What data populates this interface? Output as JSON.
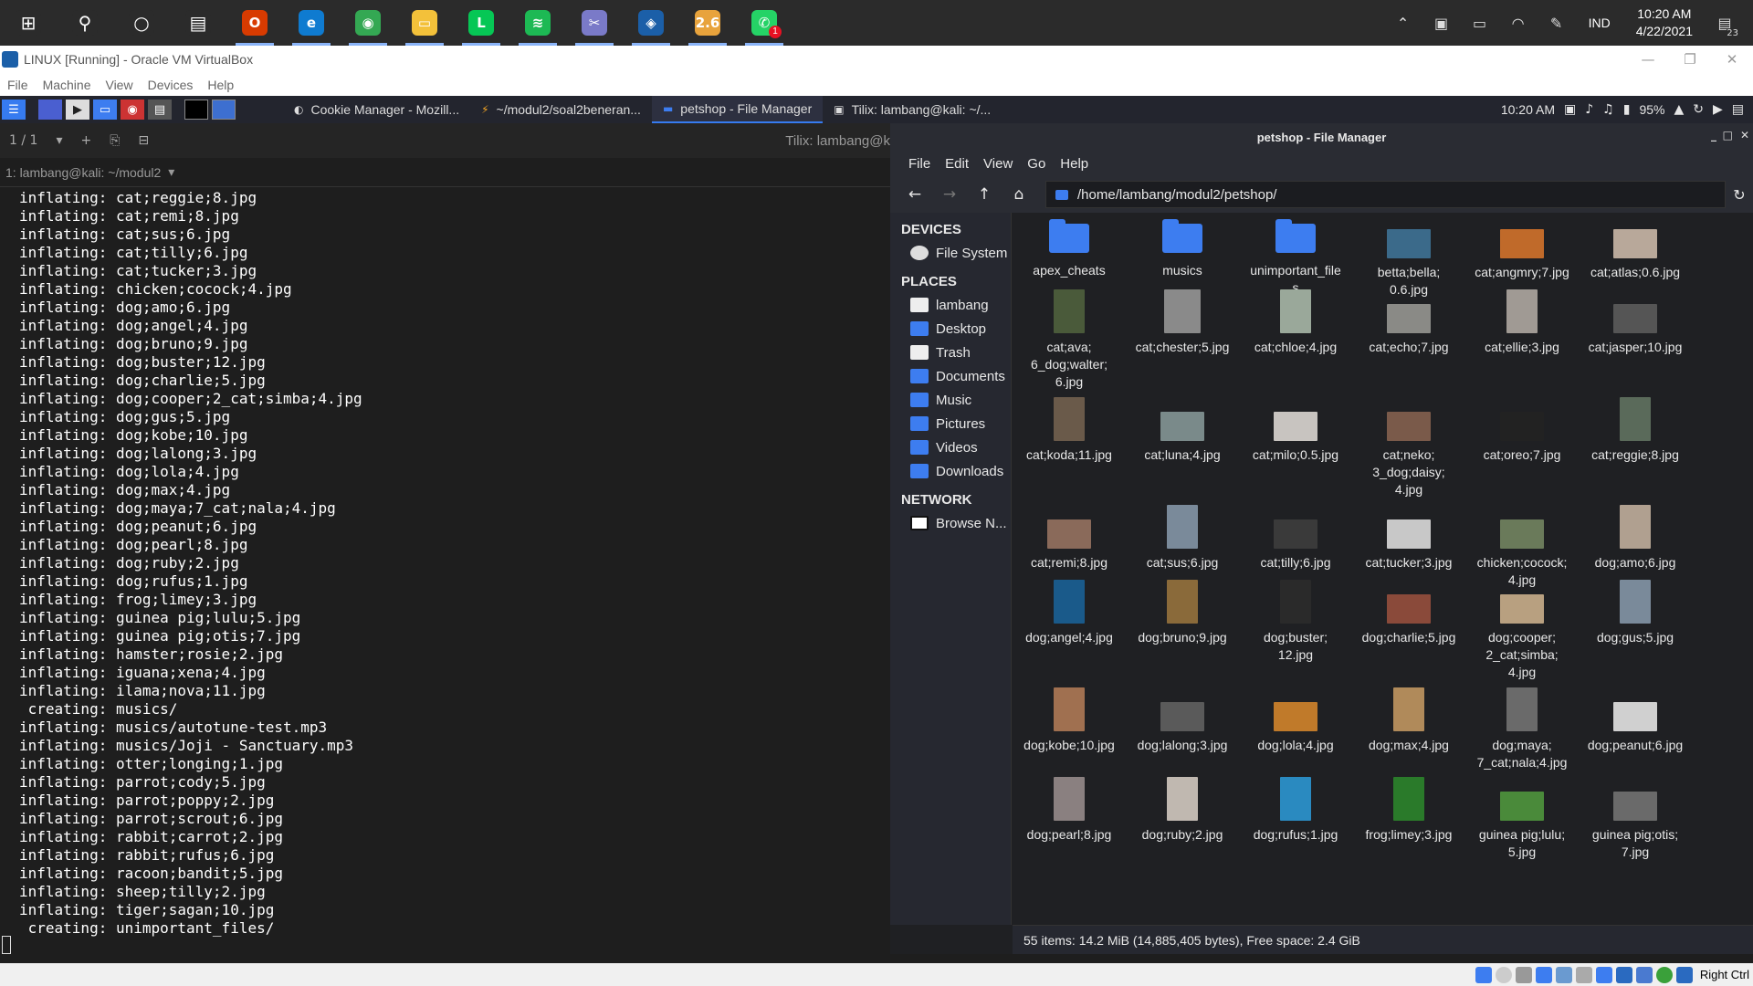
{
  "taskbar": {
    "apps": [
      {
        "name": "start",
        "glyph": "⊞",
        "color": "#2b2b2b"
      },
      {
        "name": "search",
        "glyph": "⚲",
        "color": "#2b2b2b"
      },
      {
        "name": "cortana",
        "glyph": "○",
        "color": "#2b2b2b"
      },
      {
        "name": "task-view",
        "glyph": "▤",
        "color": "#2b2b2b"
      },
      {
        "name": "office",
        "glyph": "O",
        "color": "#d83b01"
      },
      {
        "name": "edge",
        "glyph": "e",
        "color": "#0f7bd0"
      },
      {
        "name": "chrome",
        "glyph": "◉",
        "color": "#34a853"
      },
      {
        "name": "file-explorer",
        "glyph": "▭",
        "color": "#f3c13a"
      },
      {
        "name": "line",
        "glyph": "L",
        "color": "#06c755"
      },
      {
        "name": "spotify",
        "glyph": "≋",
        "color": "#1db954"
      },
      {
        "name": "snip",
        "glyph": "✂",
        "color": "#7a7ac8"
      },
      {
        "name": "virtualbox",
        "glyph": "◈",
        "color": "#1b5fa8"
      },
      {
        "name": "app-26",
        "glyph": "2.6",
        "color": "#e8a33c"
      },
      {
        "name": "whatsapp",
        "glyph": "✆",
        "color": "#25d366"
      }
    ],
    "whatsapp_badge": "1",
    "lang": "IND",
    "time": "10:20 AM",
    "date": "4/22/2021",
    "notif_count": "23"
  },
  "vbox": {
    "title": "LINUX [Running] - Oracle VM VirtualBox",
    "menu": [
      "File",
      "Machine",
      "View",
      "Devices",
      "Help"
    ],
    "host_key": "Right Ctrl"
  },
  "kali_panel": {
    "tasks": [
      {
        "label": "Cookie Manager - Mozill...",
        "glyph": "◐"
      },
      {
        "label": "~/modul2/soal2beneran...",
        "glyph": "⚡"
      },
      {
        "label": "petshop - File Manager",
        "glyph": "▬"
      },
      {
        "label": "Tilix: lambang@kali: ~/...",
        "glyph": "▣"
      }
    ],
    "time": "10:20 AM",
    "battery": "95%"
  },
  "tilix": {
    "counter": "1 / 1",
    "title": "Tilix: lambang@k",
    "session": "1: lambang@kali: ~/modul2",
    "lines": [
      "inflating: cat;reggie;8.jpg",
      "inflating: cat;remi;8.jpg",
      "inflating: cat;sus;6.jpg",
      "inflating: cat;tilly;6.jpg",
      "inflating: cat;tucker;3.jpg",
      "inflating: chicken;cocock;4.jpg",
      "inflating: dog;amo;6.jpg",
      "inflating: dog;angel;4.jpg",
      "inflating: dog;bruno;9.jpg",
      "inflating: dog;buster;12.jpg",
      "inflating: dog;charlie;5.jpg",
      "inflating: dog;cooper;2_cat;simba;4.jpg",
      "inflating: dog;gus;5.jpg",
      "inflating: dog;kobe;10.jpg",
      "inflating: dog;lalong;3.jpg",
      "inflating: dog;lola;4.jpg",
      "inflating: dog;max;4.jpg",
      "inflating: dog;maya;7_cat;nala;4.jpg",
      "inflating: dog;peanut;6.jpg",
      "inflating: dog;pearl;8.jpg",
      "inflating: dog;ruby;2.jpg",
      "inflating: dog;rufus;1.jpg",
      "inflating: frog;limey;3.jpg",
      "inflating: guinea pig;lulu;5.jpg",
      "inflating: guinea pig;otis;7.jpg",
      "inflating: hamster;rosie;2.jpg",
      "inflating: iguana;xena;4.jpg",
      "inflating: ilama;nova;11.jpg",
      " creating: musics/",
      "inflating: musics/autotune-test.mp3",
      "inflating: musics/Joji - Sanctuary.mp3",
      "inflating: otter;longing;1.jpg",
      "inflating: parrot;cody;5.jpg",
      "inflating: parrot;poppy;2.jpg",
      "inflating: parrot;scrout;6.jpg",
      "inflating: rabbit;carrot;2.jpg",
      "inflating: rabbit;rufus;6.jpg",
      "inflating: racoon;bandit;5.jpg",
      "inflating: sheep;tilly;2.jpg",
      "inflating: tiger;sagan;10.jpg",
      " creating: unimportant_files/"
    ]
  },
  "file_manager": {
    "title": "petshop - File Manager",
    "menu": [
      "File",
      "Edit",
      "View",
      "Go",
      "Help"
    ],
    "path": "/home/lambang/modul2/petshop/",
    "sidebar": {
      "devices_label": "DEVICES",
      "devices": [
        {
          "label": "File System",
          "icon": "dev"
        }
      ],
      "places_label": "PLACES",
      "places": [
        {
          "label": "lambang",
          "icon": "white"
        },
        {
          "label": "Desktop",
          "icon": "blue"
        },
        {
          "label": "Trash",
          "icon": "white"
        },
        {
          "label": "Documents",
          "icon": "blue"
        },
        {
          "label": "Music",
          "icon": "blue"
        },
        {
          "label": "Pictures",
          "icon": "blue"
        },
        {
          "label": "Videos",
          "icon": "blue"
        },
        {
          "label": "Downloads",
          "icon": "blue"
        }
      ],
      "network_label": "NETWORK",
      "network": [
        {
          "label": "Browse N...",
          "icon": "net"
        }
      ]
    },
    "items": [
      {
        "lines": [
          "apex_cheats"
        ],
        "type": "folder"
      },
      {
        "lines": [
          "musics"
        ],
        "type": "folder"
      },
      {
        "lines": [
          "unimportant_file",
          "s"
        ],
        "type": "folder"
      },
      {
        "lines": [
          "betta;bella;",
          "0.6.jpg"
        ],
        "type": "image",
        "color": "#3b6a8a",
        "shape": "land"
      },
      {
        "lines": [
          "cat;angmry;7.jpg"
        ],
        "type": "image",
        "color": "#c06a2a",
        "shape": "land"
      },
      {
        "lines": [
          "cat;atlas;0.6.jpg"
        ],
        "type": "image",
        "color": "#b8a89a",
        "shape": "land"
      },
      {
        "lines": [
          "cat;ava;",
          "6_dog;walter;",
          "6.jpg"
        ],
        "type": "image",
        "color": "#4a5a3a",
        "shape": "tall"
      },
      {
        "lines": [
          "cat;chester;5.jpg"
        ],
        "type": "image",
        "color": "#8a8a8a",
        "shape": "sq"
      },
      {
        "lines": [
          "cat;chloe;4.jpg"
        ],
        "type": "image",
        "color": "#9aa89a",
        "shape": "tall"
      },
      {
        "lines": [
          "cat;echo;7.jpg"
        ],
        "type": "image",
        "color": "#8a8a86",
        "shape": "land"
      },
      {
        "lines": [
          "cat;ellie;3.jpg"
        ],
        "type": "image",
        "color": "#a09a94",
        "shape": "tall"
      },
      {
        "lines": [
          "cat;jasper;10.jpg"
        ],
        "type": "image",
        "color": "#555555",
        "shape": "land"
      },
      {
        "lines": [
          "cat;koda;11.jpg"
        ],
        "type": "image",
        "color": "#6a5a4a",
        "shape": "tall"
      },
      {
        "lines": [
          "cat;luna;4.jpg"
        ],
        "type": "image",
        "color": "#7a8a8a",
        "shape": "land"
      },
      {
        "lines": [
          "cat;milo;0.5.jpg"
        ],
        "type": "image",
        "color": "#c8c4c0",
        "shape": "land"
      },
      {
        "lines": [
          "cat;neko;",
          "3_dog;daisy;",
          "4.jpg"
        ],
        "type": "image",
        "color": "#7a5a4a",
        "shape": "land"
      },
      {
        "lines": [
          "cat;oreo;7.jpg"
        ],
        "type": "image",
        "color": "#222222",
        "shape": "land"
      },
      {
        "lines": [
          "cat;reggie;8.jpg"
        ],
        "type": "image",
        "color": "#5a6a5a",
        "shape": "tall"
      },
      {
        "lines": [
          "cat;remi;8.jpg"
        ],
        "type": "image",
        "color": "#8a6a5a",
        "shape": "land"
      },
      {
        "lines": [
          "cat;sus;6.jpg"
        ],
        "type": "image",
        "color": "#7a8a9a",
        "shape": "tall"
      },
      {
        "lines": [
          "cat;tilly;6.jpg"
        ],
        "type": "image",
        "color": "#3a3a3a",
        "shape": "land"
      },
      {
        "lines": [
          "cat;tucker;3.jpg"
        ],
        "type": "image",
        "color": "#c8c8c8",
        "shape": "land"
      },
      {
        "lines": [
          "chicken;cocock;",
          "4.jpg"
        ],
        "type": "image",
        "color": "#6a7a5a",
        "shape": "land"
      },
      {
        "lines": [
          "dog;amo;6.jpg"
        ],
        "type": "image",
        "color": "#b0a090",
        "shape": "tall"
      },
      {
        "lines": [
          "dog;angel;4.jpg"
        ],
        "type": "image",
        "color": "#1a5a8a",
        "shape": "tall"
      },
      {
        "lines": [
          "dog;bruno;9.jpg"
        ],
        "type": "image",
        "color": "#8a6a3a",
        "shape": "tall"
      },
      {
        "lines": [
          "dog;buster;",
          "12.jpg"
        ],
        "type": "image",
        "color": "#2a2a2a",
        "shape": "tall"
      },
      {
        "lines": [
          "dog;charlie;5.jpg"
        ],
        "type": "image",
        "color": "#8a4a3a",
        "shape": "land"
      },
      {
        "lines": [
          "dog;cooper;",
          "2_cat;simba;",
          "4.jpg"
        ],
        "type": "image",
        "color": "#b8a080",
        "shape": "land"
      },
      {
        "lines": [
          "dog;gus;5.jpg"
        ],
        "type": "image",
        "color": "#7a8a9a",
        "shape": "tall"
      },
      {
        "lines": [
          "dog;kobe;10.jpg"
        ],
        "type": "image",
        "color": "#a07050",
        "shape": "tall"
      },
      {
        "lines": [
          "dog;lalong;3.jpg"
        ],
        "type": "image",
        "color": "#5a5a5a",
        "shape": "land"
      },
      {
        "lines": [
          "dog;lola;4.jpg"
        ],
        "type": "image",
        "color": "#c07a2a",
        "shape": "land"
      },
      {
        "lines": [
          "dog;max;4.jpg"
        ],
        "type": "image",
        "color": "#b08a5a",
        "shape": "tall"
      },
      {
        "lines": [
          "dog;maya;",
          "7_cat;nala;4.jpg"
        ],
        "type": "image",
        "color": "#6a6a6a",
        "shape": "tall"
      },
      {
        "lines": [
          "dog;peanut;6.jpg"
        ],
        "type": "image",
        "color": "#d0d0d0",
        "shape": "land"
      },
      {
        "lines": [
          "dog;pearl;8.jpg"
        ],
        "type": "image",
        "color": "#8a8080",
        "shape": "tall"
      },
      {
        "lines": [
          "dog;ruby;2.jpg"
        ],
        "type": "image",
        "color": "#c0b8b0",
        "shape": "tall"
      },
      {
        "lines": [
          "dog;rufus;1.jpg"
        ],
        "type": "image",
        "color": "#2a8ac0",
        "shape": "tall"
      },
      {
        "lines": [
          "frog;limey;3.jpg"
        ],
        "type": "image",
        "color": "#2a7a2a",
        "shape": "tall"
      },
      {
        "lines": [
          "guinea pig;lulu;",
          "5.jpg"
        ],
        "type": "image",
        "color": "#4a8a3a",
        "shape": "land"
      },
      {
        "lines": [
          "guinea pig;otis;",
          "7.jpg"
        ],
        "type": "image",
        "color": "#6a6a6a",
        "shape": "land"
      }
    ],
    "status": "55 items: 14.2 MiB (14,885,405 bytes), Free space: 2.4 GiB"
  }
}
